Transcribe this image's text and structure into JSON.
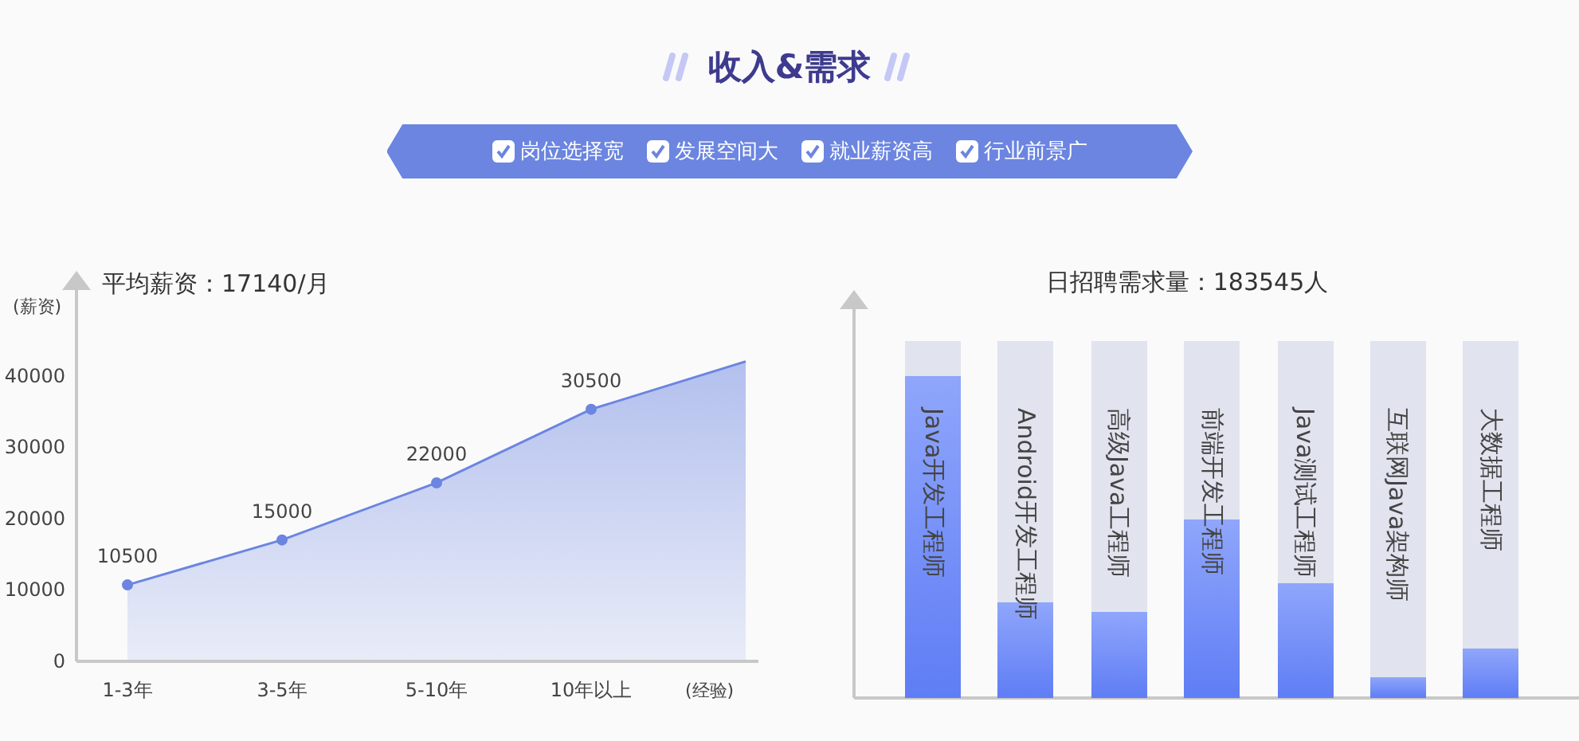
{
  "title": "收入&需求",
  "features": [
    {
      "label": "岗位选择宽",
      "checked": true
    },
    {
      "label": "发展空间大",
      "checked": true
    },
    {
      "label": "就业薪资高",
      "checked": true
    },
    {
      "label": "行业前景广",
      "checked": true
    }
  ],
  "salary_chart": {
    "title": "平均薪资：17140/月",
    "chart_data": {
      "type": "area",
      "ylabel": "(薪资)",
      "xlabel": "(经验)",
      "categories": [
        "1-3年",
        "3-5年",
        "5-10年",
        "10年以上",
        null
      ],
      "series": [
        {
          "color": "#6b85e0",
          "values": [
            10700,
            17000,
            25000,
            35300,
            42000
          ]
        }
      ],
      "ylim": [
        0,
        52000
      ],
      "yticks": [
        0,
        10000,
        20000,
        30000,
        40000
      ],
      "annotations": [
        {
          "x": "1-3年",
          "y": 10700,
          "text": "10500"
        },
        {
          "x": "3-5年",
          "y": 17000,
          "text": "15000"
        },
        {
          "x": "5-10年",
          "y": 25000,
          "text": "22000"
        },
        {
          "x": "10年以上",
          "y": 35300,
          "text": "30500"
        }
      ]
    }
  },
  "demand_chart": {
    "title": "日招聘需求量：183545人",
    "bars": [
      {
        "label": "Java开发工程师",
        "level": 0.9
      },
      {
        "label": "Android开发工程师",
        "level": 0.27
      },
      {
        "label": "高级Java工程师",
        "level": 0.24
      },
      {
        "label": "前端开发工程师",
        "level": 0.5
      },
      {
        "label": "Java测试工程师",
        "level": 0.32
      },
      {
        "label": "互联网Java架构师",
        "level": 0.06
      },
      {
        "label": "大数据工程师",
        "level": 0.14
      }
    ]
  }
}
